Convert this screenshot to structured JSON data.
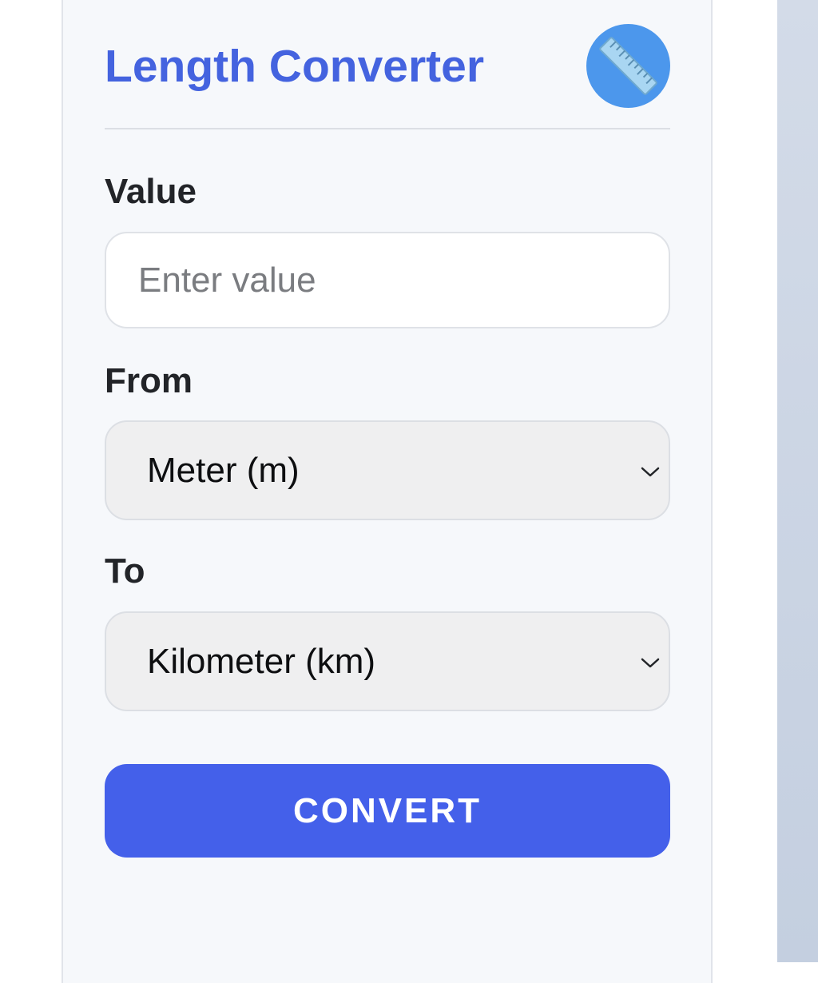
{
  "header": {
    "title": "Length Converter",
    "icon": "ruler-icon"
  },
  "form": {
    "value_label": "Value",
    "value_placeholder": "Enter value",
    "value": "",
    "from_label": "From",
    "from_selected": "Meter (m)",
    "to_label": "To",
    "to_selected": "Kilometer (km)",
    "convert_label": "CONVERT"
  },
  "colors": {
    "accent": "#4463df",
    "button": "#4460ea",
    "icon_circle": "#4c97ec",
    "card_background": "#f6f8fb",
    "select_background": "#efeff0"
  }
}
